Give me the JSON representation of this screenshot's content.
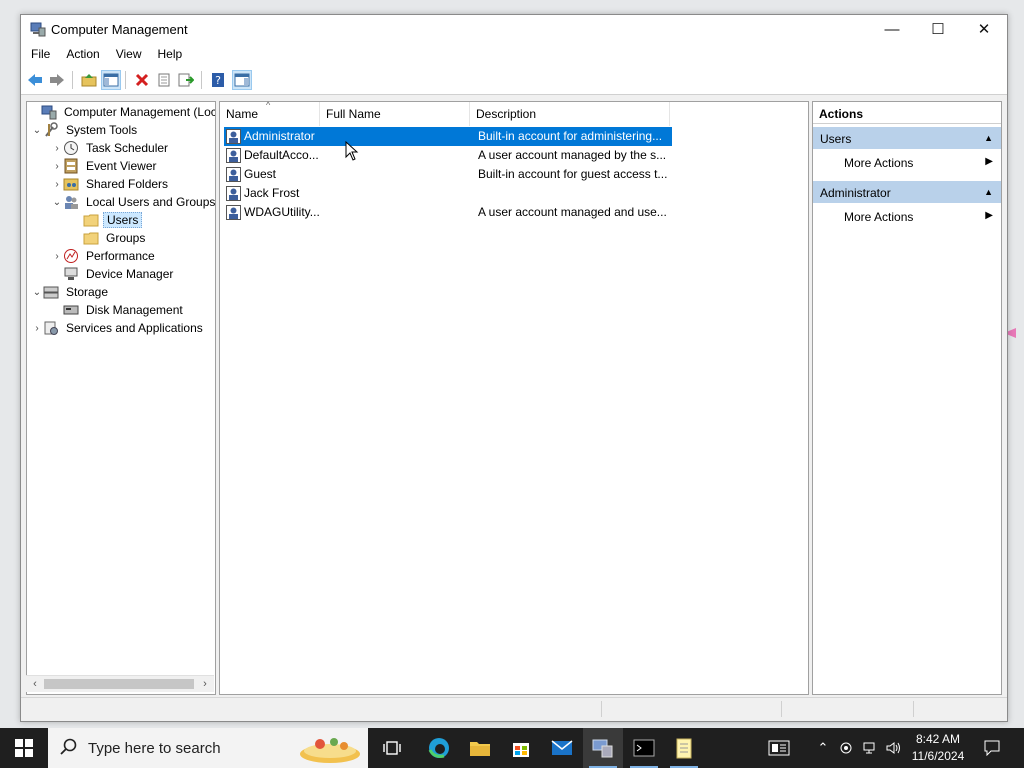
{
  "window": {
    "title": "Computer Management",
    "minimize_glyph": "—",
    "maximize_glyph": "☐",
    "close_glyph": "✕"
  },
  "menu": [
    "File",
    "Action",
    "View",
    "Help"
  ],
  "toolbar": {
    "buttons": [
      "back-icon",
      "forward-icon",
      "up-folder-icon",
      "show-hide-console-tree-icon",
      "delete-icon",
      "properties-icon",
      "export-list-icon",
      "help-icon",
      "show-hide-action-pane-icon"
    ]
  },
  "tree": {
    "items": [
      {
        "label": "Computer Management (Local",
        "icon": "computer-management-icon",
        "expander": ""
      },
      {
        "label": "System Tools",
        "icon": "tools-icon",
        "expander": "v"
      },
      {
        "label": "Task Scheduler",
        "icon": "clock-icon",
        "expander": ">"
      },
      {
        "label": "Event Viewer",
        "icon": "event-viewer-icon",
        "expander": ">"
      },
      {
        "label": "Shared Folders",
        "icon": "shared-folder-icon",
        "expander": ">"
      },
      {
        "label": "Local Users and Groups",
        "icon": "users-icon",
        "expander": "v"
      },
      {
        "label": "Users",
        "icon": "folder-icon",
        "expander": ""
      },
      {
        "label": "Groups",
        "icon": "folder-icon",
        "expander": ""
      },
      {
        "label": "Performance",
        "icon": "performance-icon",
        "expander": ">"
      },
      {
        "label": "Device Manager",
        "icon": "device-manager-icon",
        "expander": ""
      },
      {
        "label": "Storage",
        "icon": "storage-icon",
        "expander": "v"
      },
      {
        "label": "Disk Management",
        "icon": "disk-icon",
        "expander": ""
      },
      {
        "label": "Services and Applications",
        "icon": "services-icon",
        "expander": ">"
      }
    ]
  },
  "list": {
    "columns": [
      "Name",
      "Full Name",
      "Description"
    ],
    "sort_indicator": "^",
    "rows": [
      {
        "name": "Administrator",
        "full_name": "",
        "description": "Built-in account for administering..."
      },
      {
        "name": "DefaultAcco...",
        "full_name": "",
        "description": "A user account managed by the s..."
      },
      {
        "name": "Guest",
        "full_name": "",
        "description": "Built-in account for guest access t..."
      },
      {
        "name": "Jack Frost",
        "full_name": "",
        "description": ""
      },
      {
        "name": "WDAGUtility...",
        "full_name": "",
        "description": "A user account managed and use..."
      }
    ]
  },
  "actions": {
    "header": "Actions",
    "sections": [
      {
        "title": "Users",
        "item": "More Actions"
      },
      {
        "title": "Administrator",
        "item": "More Actions"
      }
    ]
  },
  "taskbar": {
    "search_placeholder": "Type here to search",
    "apps": [
      "task-view-icon",
      "edge-icon",
      "file-explorer-icon",
      "store-icon",
      "mail-icon",
      "computer-management-icon",
      "terminal-icon",
      "notepad-icon"
    ],
    "clock_time": "8:42 AM",
    "clock_date": "11/6/2024"
  },
  "colors": {
    "selection": "#0078d7",
    "actions_section": "#b9d1ea",
    "taskbar": "#1f1f1f"
  }
}
